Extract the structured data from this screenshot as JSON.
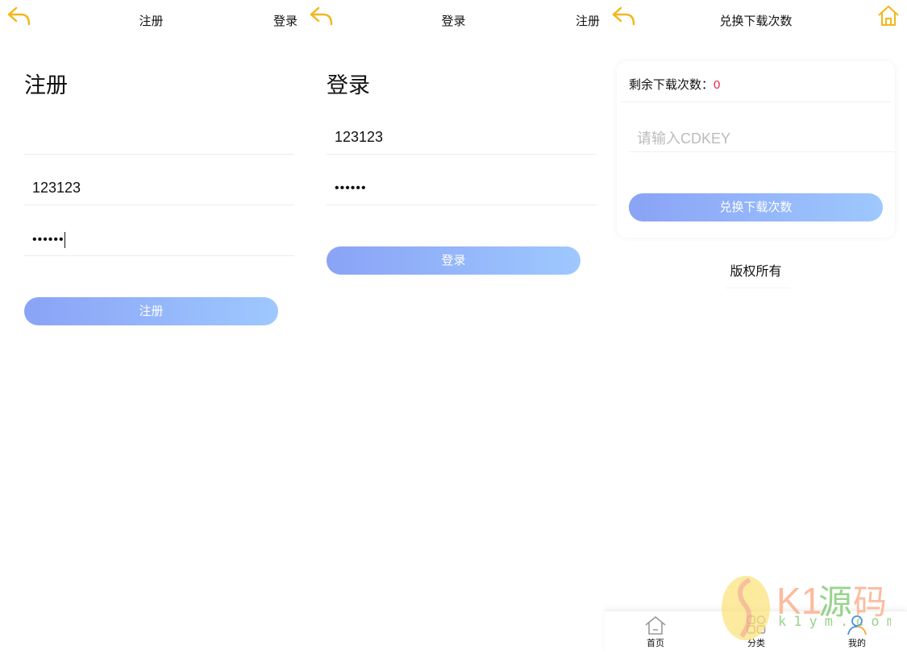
{
  "register": {
    "header": {
      "title": "注册",
      "right_link": "登录"
    },
    "heading": "注册",
    "fields": {
      "first": "",
      "second": "123123",
      "password": "••••••"
    },
    "button": "注册"
  },
  "login": {
    "header": {
      "title": "登录",
      "right_link": "注册"
    },
    "heading": "登录",
    "fields": {
      "username": "123123",
      "password": "••••••"
    },
    "button": "登录"
  },
  "redeem": {
    "header": {
      "title": "兑换下载次数"
    },
    "remaining_label": "剩余下载次数：",
    "remaining_value": "0",
    "cdkey_placeholder": "请输入CDKEY",
    "button": "兑换下载次数",
    "copyright": "版权所有",
    "nav": [
      {
        "label": "首页"
      },
      {
        "label": "分类"
      },
      {
        "label": "我的"
      }
    ]
  },
  "watermark": {
    "brand": "K1源码",
    "url": "k1ym.com"
  },
  "colors": {
    "accent": "#f2b71a",
    "gradient_start": "#8aa3f6",
    "gradient_end": "#9ec8fe",
    "count": "#e8264a"
  }
}
